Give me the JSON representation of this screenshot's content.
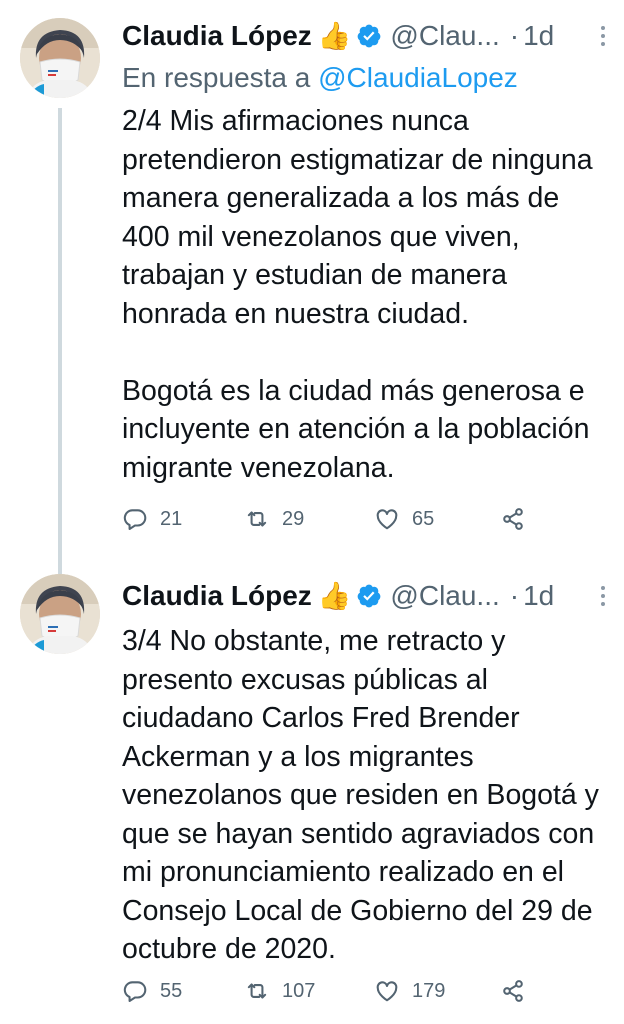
{
  "tweets": [
    {
      "author_name": "Claudia López",
      "handle": "@Clau...",
      "time_separator": "·",
      "time": "1d",
      "reply_prefix": "En respuesta a",
      "reply_mention": "@ClaudiaLopez",
      "paragraph_1": "2/4 Mis afirmaciones nunca pretendieron estigmatizar de ninguna manera generalizada a los más de 400 mil venezolanos que viven, trabajan y estudian de manera honrada en nuestra ciudad.",
      "paragraph_2": "Bogotá es la ciudad más generosa e incluyente en atención a la población migrante venezolana.",
      "replies": "21",
      "retweets": "29",
      "likes": "65"
    },
    {
      "author_name": "Claudia López",
      "handle": "@Clau...",
      "time_separator": "·",
      "time": "1d",
      "paragraph_1": "3/4 No obstante, me retracto y presento excusas públicas al ciudadano Carlos Fred Brender Ackerman y a los migrantes venezolanos que residen en Bogotá y que se hayan sentido agraviados con mi pronunciamiento realizado en el Consejo Local de Gobierno del 29 de octubre de 2020.",
      "replies": "55",
      "retweets": "107",
      "likes": "179"
    }
  ],
  "icons": {
    "author_badge": "thumbs-up-icon",
    "verified": "verified-badge-icon",
    "more": "more-vertical-icon",
    "reply": "reply-icon",
    "retweet": "retweet-icon",
    "like": "heart-icon",
    "share": "share-icon"
  },
  "colors": {
    "text": "#0f1419",
    "secondary": "#536471",
    "link": "#1d9bf0",
    "thread_line": "#cfd9de"
  }
}
